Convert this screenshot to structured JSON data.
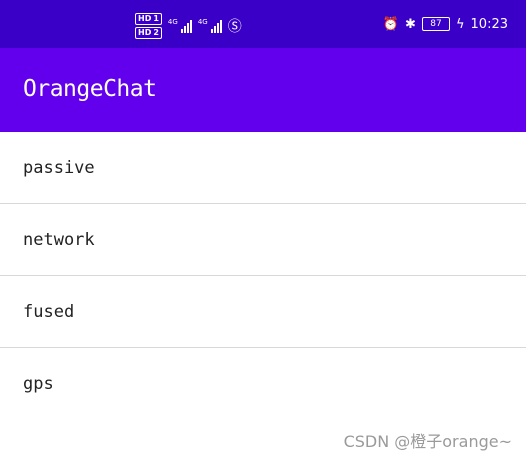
{
  "status_bar": {
    "hd1": "HD",
    "hd1_sub": "1",
    "hd2": "HD",
    "hd2_sub": "2",
    "net1": "4G",
    "net2": "4G",
    "battery": "87",
    "time": "10:23"
  },
  "app_bar": {
    "title": "OrangeChat"
  },
  "list": [
    {
      "label": "passive"
    },
    {
      "label": "network"
    },
    {
      "label": "fused"
    },
    {
      "label": "gps"
    }
  ],
  "watermark": "CSDN @橙子orange~",
  "colors": {
    "status_bar": "#3a00c8",
    "app_bar": "#6200ee"
  }
}
